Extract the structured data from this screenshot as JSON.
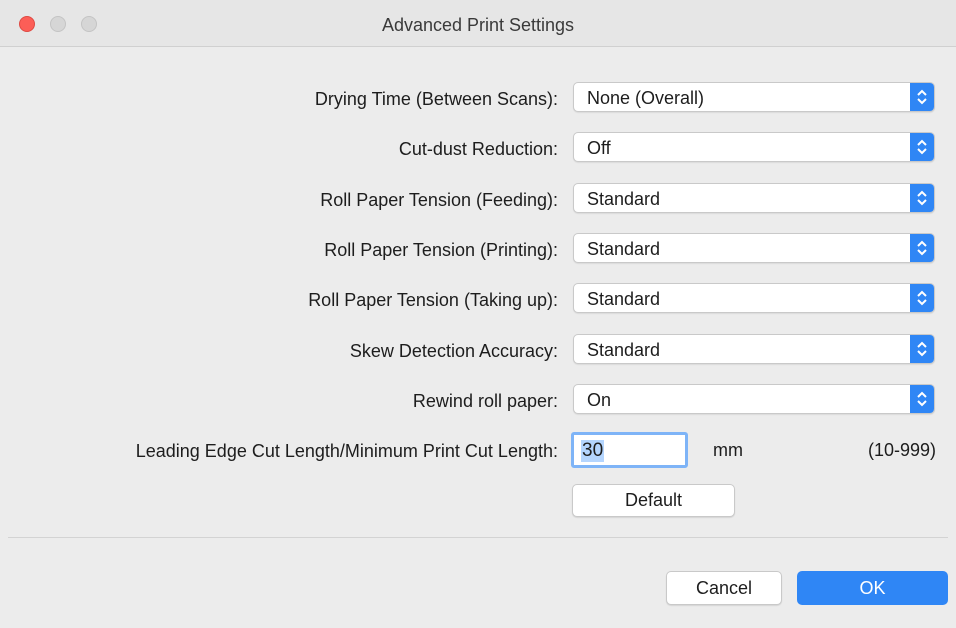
{
  "window": {
    "title": "Advanced Print Settings"
  },
  "settings": [
    {
      "label": "Drying Time (Between Scans):",
      "value": "None (Overall)"
    },
    {
      "label": "Cut-dust Reduction:",
      "value": "Off"
    },
    {
      "label": "Roll Paper Tension (Feeding):",
      "value": "Standard"
    },
    {
      "label": "Roll Paper Tension (Printing):",
      "value": "Standard"
    },
    {
      "label": "Roll Paper Tension (Taking up):",
      "value": "Standard"
    },
    {
      "label": "Skew Detection Accuracy:",
      "value": "Standard"
    },
    {
      "label": "Rewind roll paper:",
      "value": "On"
    }
  ],
  "cut_length": {
    "label": "Leading Edge Cut Length/Minimum Print Cut Length:",
    "value": "30",
    "unit": "mm",
    "range": "(10-999)",
    "default_label": "Default"
  },
  "buttons": {
    "cancel": "Cancel",
    "ok": "OK"
  },
  "colors": {
    "accent": "#2f86f5",
    "close": "#fc5e57"
  }
}
